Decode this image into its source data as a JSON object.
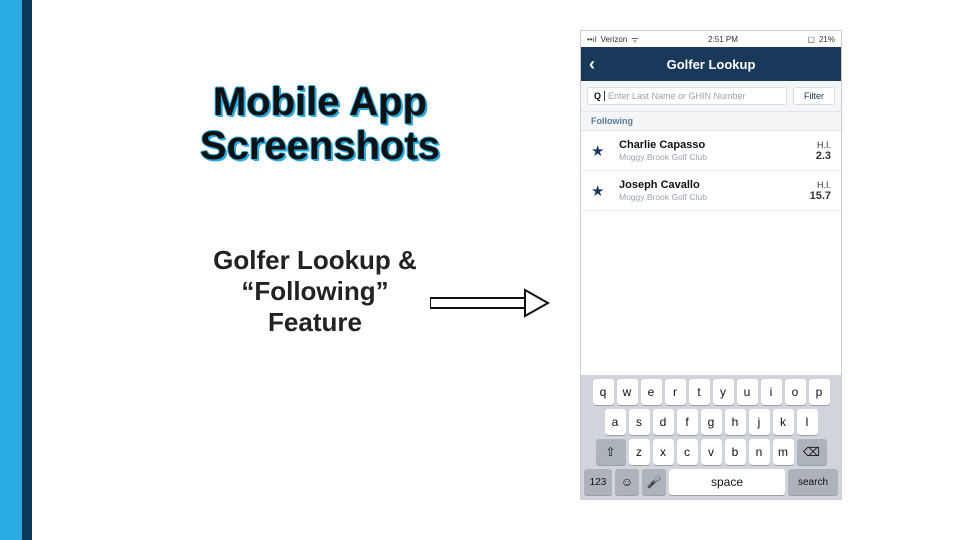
{
  "slide": {
    "title": "Mobile App Screenshots",
    "subtitle": "Golfer Lookup & “Following” Feature"
  },
  "phone": {
    "status": {
      "carrier": "Verizon",
      "wifi": "▲",
      "time": "2:51 PM",
      "battery": "21%"
    },
    "nav": {
      "back_glyph": "‹",
      "title": "Golfer Lookup"
    },
    "search": {
      "prefix": "Q",
      "placeholder": "Enter Last Name or GHIN Number",
      "filter_label": "Filter"
    },
    "section_label": "Following",
    "golfers": [
      {
        "name": "Charlie Capasso",
        "club": "Moggy Brook Golf Club",
        "hi_label": "H.I.",
        "hi_value": "2.3"
      },
      {
        "name": "Joseph Cavallo",
        "club": "Moggy Brook Golf Club",
        "hi_label": "H.I.",
        "hi_value": "15.7"
      }
    ],
    "keyboard": {
      "row1": [
        "q",
        "w",
        "e",
        "r",
        "t",
        "y",
        "u",
        "i",
        "o",
        "p"
      ],
      "row2": [
        "a",
        "s",
        "d",
        "f",
        "g",
        "h",
        "j",
        "k",
        "l"
      ],
      "row3_shift": "⇧",
      "row3": [
        "z",
        "x",
        "c",
        "v",
        "b",
        "n",
        "m"
      ],
      "row3_del": "⌫",
      "bottom": {
        "num": "123",
        "emoji": "☺",
        "mic": "↓",
        "space": "space",
        "search": "search"
      }
    }
  }
}
